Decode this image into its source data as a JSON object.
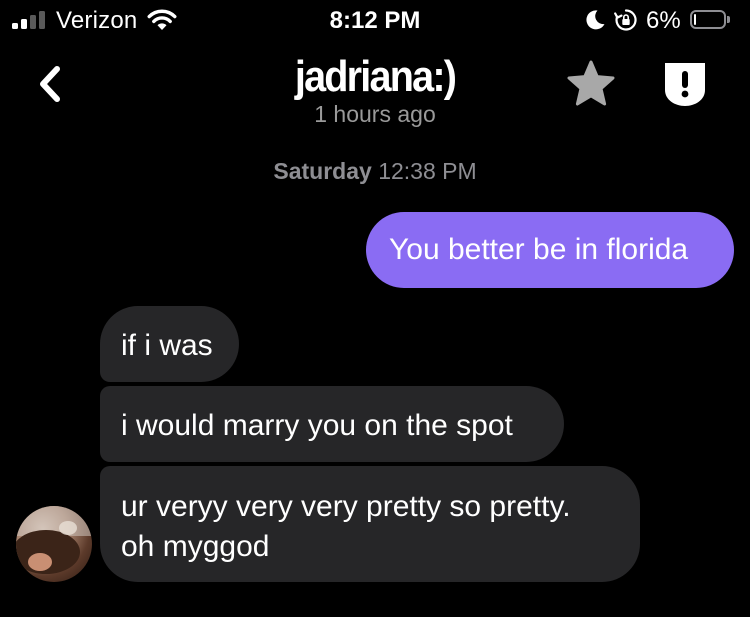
{
  "status_bar": {
    "carrier": "Verizon",
    "time": "8:12 PM",
    "battery_percent": "6%",
    "battery_level": 0.06,
    "signal_bars_active": 2,
    "signal_bars_total": 4,
    "icons": [
      "signal-icon",
      "wifi-icon",
      "moon-icon",
      "rotation-lock-icon",
      "battery-icon"
    ]
  },
  "header": {
    "contact_name": "jadriana:)",
    "last_seen": "1 hours ago",
    "icons": [
      "back-chevron-icon",
      "star-icon",
      "shield-alert-icon"
    ]
  },
  "conversation": {
    "timestamp_day": "Saturday",
    "timestamp_time": "12:38 PM",
    "messages": [
      {
        "direction": "outgoing",
        "text": "You better be in florida"
      },
      {
        "direction": "incoming",
        "text": "if i was"
      },
      {
        "direction": "incoming",
        "text": "i would marry you on the spot"
      },
      {
        "direction": "incoming",
        "lines": [
          "ur veryy very very pretty so pretty.",
          "oh myggod"
        ]
      }
    ]
  },
  "colors": {
    "background": "#000000",
    "outgoing_bubble": "#8a6cf3",
    "incoming_bubble": "#262628",
    "secondary_text": "#9a9a9a",
    "icon_gray": "#8e8e93"
  }
}
